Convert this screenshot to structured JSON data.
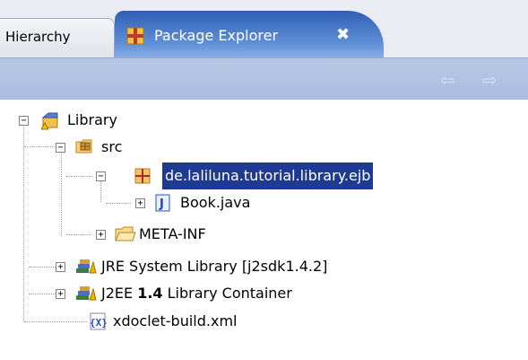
{
  "tabs": {
    "hierarchy_label": "Hierarchy",
    "package_explorer_label": "Package Explorer",
    "close_glyph": "✖"
  },
  "toolbar": {
    "back_glyph": "⇦",
    "forward_glyph": "⇨"
  },
  "tree": {
    "project": "Library",
    "src": "src",
    "package": "de.laliluna.tutorial.library.ejb",
    "java_file": "Book.java",
    "meta_inf": "META-INF",
    "jre_lib": "JRE System Library [j2sdk1.4.2]",
    "j2ee_lib_prefix": "J2EE ",
    "j2ee_lib_version": "1.4",
    "j2ee_lib_suffix": " Library Container",
    "xml_file": "xdoclet-build.xml"
  },
  "colors": {
    "selection": "#1f3a93",
    "active_tab": "#4a78c8"
  }
}
